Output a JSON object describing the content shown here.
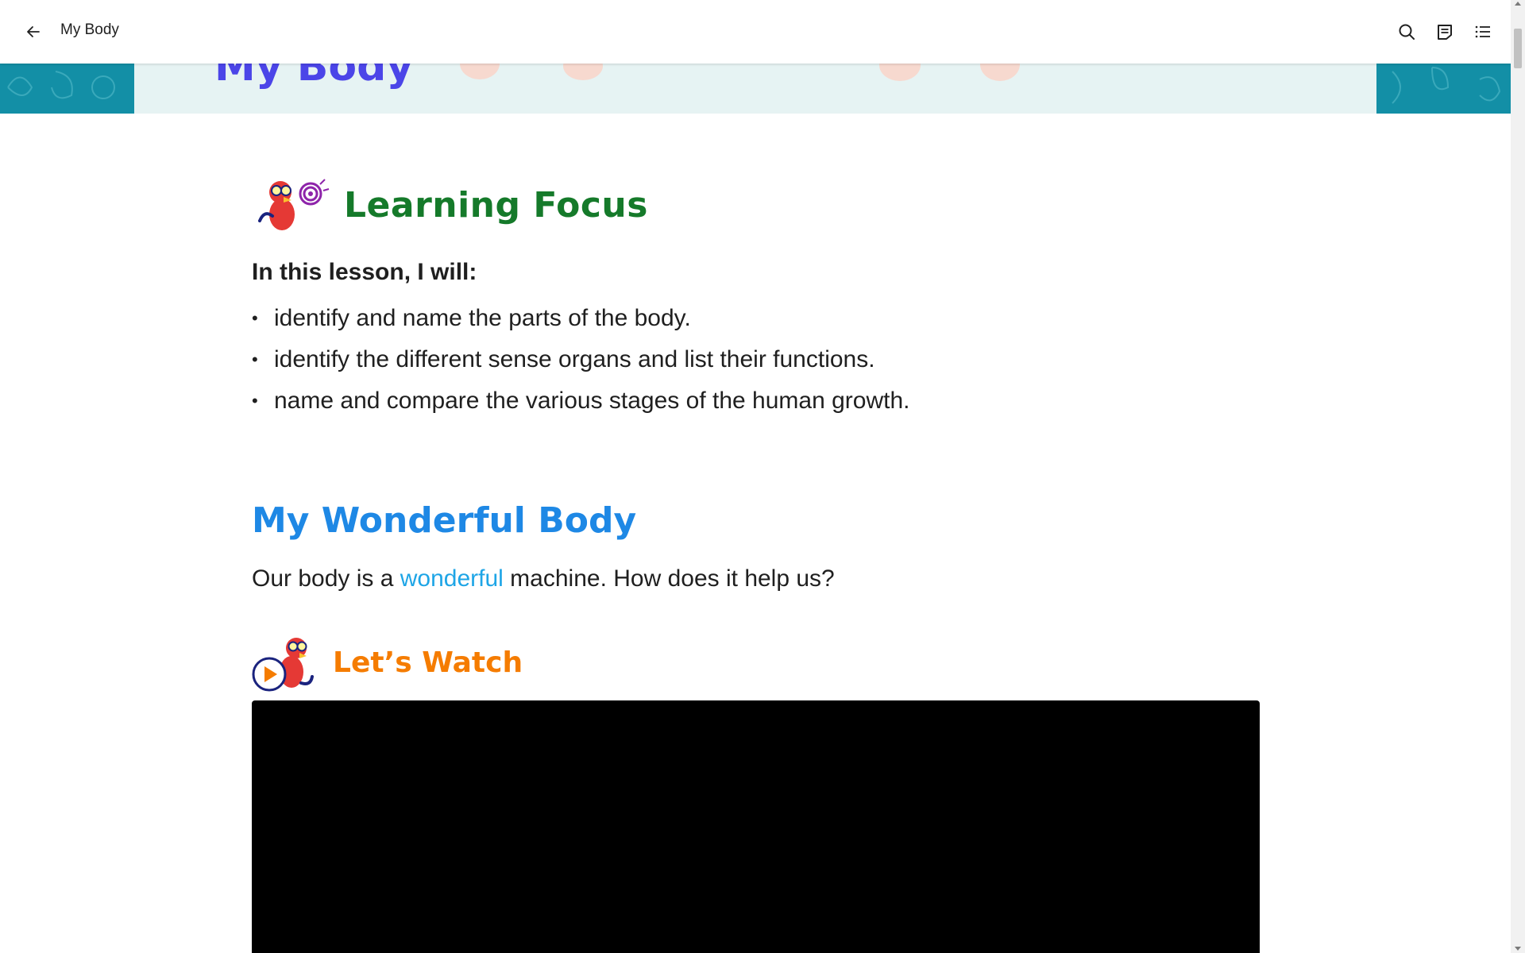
{
  "topbar": {
    "title": "My Body",
    "icons": {
      "back": "back-arrow-icon",
      "search": "search-icon",
      "notes": "notes-icon",
      "toc": "table-of-contents-icon"
    }
  },
  "banner": {
    "title": "My Body",
    "colors": {
      "outer": "#138fa6",
      "inner": "#e6f3f3",
      "title": "#4b45e8"
    }
  },
  "learning_focus": {
    "title": "Learning Focus",
    "intro": "In this lesson, I will:",
    "items": [
      "identify and name the parts of the body.",
      "identify the different sense organs and list their functions.",
      "name and compare the various stages of the human growth."
    ],
    "color": "#157a2a"
  },
  "wonderful_body": {
    "title": "My Wonderful Body",
    "text_before": "Our body is a ",
    "text_highlight": "wonderful",
    "text_after": " machine. How does it help us?",
    "color": "#1e88e5"
  },
  "lets_watch": {
    "title": "Let’s Watch",
    "color": "#f57c00"
  }
}
